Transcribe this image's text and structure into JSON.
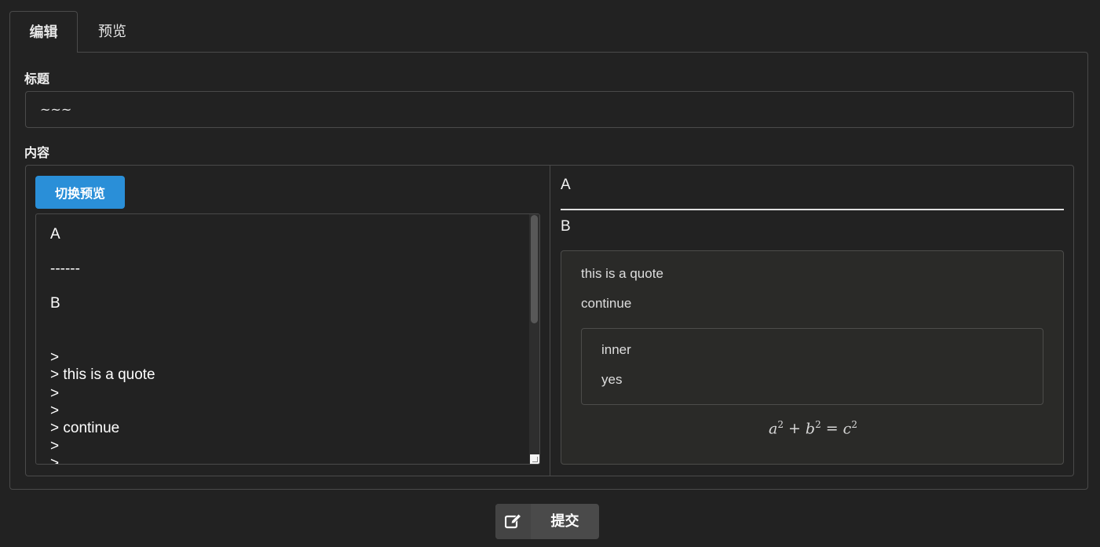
{
  "tabs": [
    {
      "label": "编辑",
      "active": true
    },
    {
      "label": "预览",
      "active": false
    }
  ],
  "form": {
    "title_label": "标题",
    "title_value": "~~~",
    "content_label": "内容"
  },
  "editor": {
    "toggle_label": "切换预览",
    "lines": [
      "A",
      "------",
      "B",
      "",
      ">",
      "> this is a quote",
      ">",
      ">",
      "> continue",
      ">",
      ">"
    ]
  },
  "preview": {
    "heading_a": "A",
    "heading_b": "B",
    "quote": {
      "line1": "this is a quote",
      "line2": "continue",
      "inner": {
        "line1": "inner",
        "line2": "yes"
      }
    },
    "math": {
      "a": "a",
      "b": "b",
      "c": "c",
      "exp": "2",
      "plus": "+",
      "eq": "="
    }
  },
  "submit": {
    "label": "提交",
    "icon": "edit-icon"
  },
  "colors": {
    "background": "#222222",
    "accent": "#2a8fd8",
    "border": "#4a4a4a"
  }
}
